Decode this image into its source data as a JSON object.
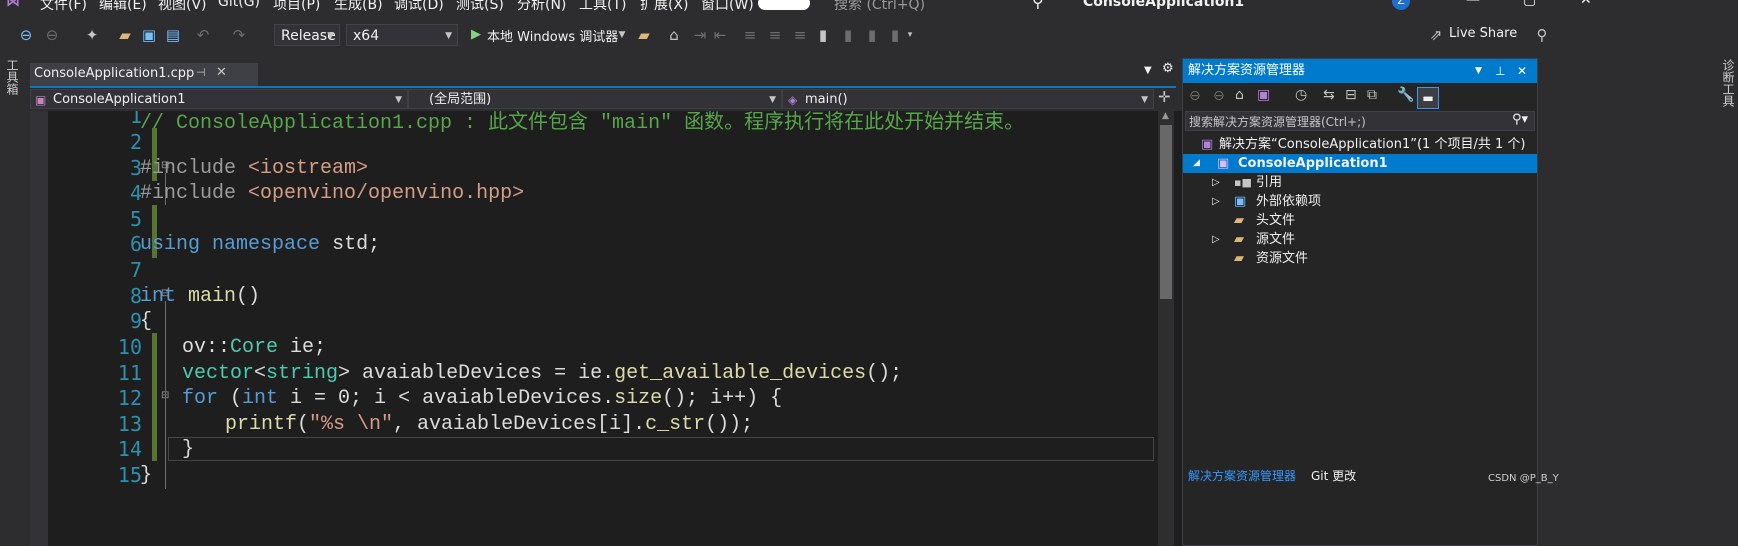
{
  "menu": {
    "items": [
      "文件(F)",
      "编辑(E)",
      "视图(V)",
      "Git(G)",
      "项目(P)",
      "生成(B)",
      "调试(D)",
      "测试(S)",
      "分析(N)",
      "工具(T)",
      "扩展(X)",
      "窗口(W)"
    ],
    "search_placeholder": "搜索 (Ctrl+Q)",
    "app_title": "ConsoleApplication1",
    "avatar_initial": "Z"
  },
  "toolbar": {
    "config": "Release",
    "platform": "x64",
    "run_label": "本地 Windows 调试器",
    "live_share": "Live Share"
  },
  "left_strip_label": "工具箱",
  "right_strip_label": "诊断工具",
  "editor": {
    "tab_title": "ConsoleApplication1.cpp",
    "nav_project": "ConsoleApplication1",
    "nav_scope": "(全局范围)",
    "nav_member": "main()",
    "lines": [
      "1",
      "2",
      "3",
      "4",
      "5",
      "6",
      "7",
      "8",
      "9",
      "10",
      "11",
      "12",
      "13",
      "14",
      "15"
    ]
  },
  "solution_explorer": {
    "title": "解决方案资源管理器",
    "search_placeholder": "搜索解决方案资源管理器(Ctrl+;)",
    "solution_label": "解决方案“ConsoleApplication1”(1 个项目/共 1 个)",
    "project_label": "ConsoleApplication1",
    "nodes": [
      "引用",
      "外部依赖项",
      "头文件",
      "源文件",
      "资源文件"
    ],
    "bottom_tabs": [
      "解决方案资源管理器",
      "Git 更改"
    ]
  },
  "watermark": "CSDN @P_B_Y",
  "colors": {
    "accent": "#007acc",
    "background": "#2d2d30",
    "editor_bg": "#1e1e1e"
  }
}
